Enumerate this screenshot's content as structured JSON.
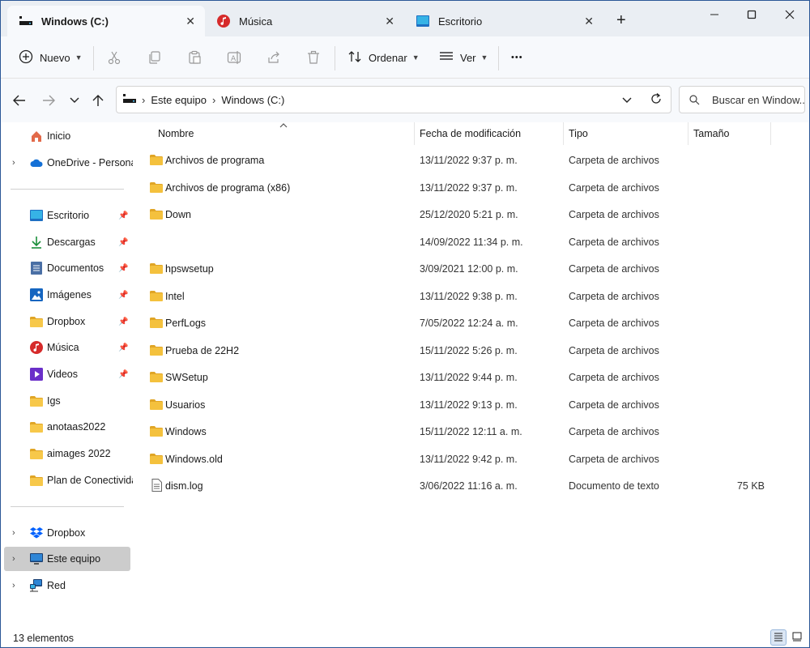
{
  "tabs": [
    {
      "label": "Windows (C:)",
      "icon": "drive-icon"
    },
    {
      "label": "Música",
      "icon": "music-icon"
    },
    {
      "label": "Escritorio",
      "icon": "desktop-icon"
    }
  ],
  "commandbar": {
    "new_label": "Nuevo",
    "sort_label": "Ordenar",
    "view_label": "Ver",
    "more_label": "•••"
  },
  "address": {
    "crumbs": [
      "Este equipo",
      "Windows (C:)"
    ]
  },
  "search": {
    "placeholder": "Buscar en Window..."
  },
  "sidebar": {
    "home": "Inicio",
    "onedrive": "OneDrive - Persona",
    "quick": [
      {
        "label": "Escritorio",
        "icon": "desktop-icon",
        "pinned": true
      },
      {
        "label": "Descargas",
        "icon": "download-icon",
        "pinned": true
      },
      {
        "label": "Documentos",
        "icon": "documents-icon",
        "pinned": true
      },
      {
        "label": "Imágenes",
        "icon": "pictures-icon",
        "pinned": true
      },
      {
        "label": "Dropbox",
        "icon": "folder-icon",
        "pinned": true
      },
      {
        "label": "Música",
        "icon": "music-icon",
        "pinned": true
      },
      {
        "label": "Videos",
        "icon": "videos-icon",
        "pinned": true
      },
      {
        "label": "Igs",
        "icon": "folder-icon",
        "pinned": false
      },
      {
        "label": "anotaas2022",
        "icon": "folder-icon",
        "pinned": false
      },
      {
        "label": "aimages 2022",
        "icon": "folder-icon",
        "pinned": false
      },
      {
        "label": "Plan de Conectividad",
        "icon": "folder-icon",
        "pinned": false
      }
    ],
    "bottom": [
      {
        "label": "Dropbox",
        "icon": "dropbox-icon"
      },
      {
        "label": "Este equipo",
        "icon": "computer-icon"
      },
      {
        "label": "Red",
        "icon": "network-icon"
      }
    ]
  },
  "columns": {
    "name": "Nombre",
    "date": "Fecha de modificación",
    "type": "Tipo",
    "size": "Tamaño"
  },
  "files": [
    {
      "name": "Archivos de programa",
      "date": "13/11/2022 9:37 p. m.",
      "type": "Carpeta de archivos",
      "size": "",
      "kind": "folder"
    },
    {
      "name": "Archivos de programa (x86)",
      "date": "13/11/2022 9:37 p. m.",
      "type": "Carpeta de archivos",
      "size": "",
      "kind": "folder"
    },
    {
      "name": "Down",
      "date": "25/12/2020 5:21 p. m.",
      "type": "Carpeta de archivos",
      "size": "",
      "kind": "folder"
    },
    {
      "name": "",
      "date": "14/09/2022 11:34 p. m.",
      "type": "Carpeta de archivos",
      "size": "",
      "kind": "none"
    },
    {
      "name": "hpswsetup",
      "date": "3/09/2021 12:00 p. m.",
      "type": "Carpeta de archivos",
      "size": "",
      "kind": "folder"
    },
    {
      "name": "Intel",
      "date": "13/11/2022 9:38 p. m.",
      "type": "Carpeta de archivos",
      "size": "",
      "kind": "folder"
    },
    {
      "name": "PerfLogs",
      "date": "7/05/2022 12:24 a. m.",
      "type": "Carpeta de archivos",
      "size": "",
      "kind": "folder"
    },
    {
      "name": "Prueba de 22H2",
      "date": "15/11/2022 5:26 p. m.",
      "type": "Carpeta de archivos",
      "size": "",
      "kind": "folder"
    },
    {
      "name": "SWSetup",
      "date": "13/11/2022 9:44 p. m.",
      "type": "Carpeta de archivos",
      "size": "",
      "kind": "folder"
    },
    {
      "name": "Usuarios",
      "date": "13/11/2022 9:13 p. m.",
      "type": "Carpeta de archivos",
      "size": "",
      "kind": "folder"
    },
    {
      "name": "Windows",
      "date": "15/11/2022 12:11 a. m.",
      "type": "Carpeta de archivos",
      "size": "",
      "kind": "folder"
    },
    {
      "name": "Windows.old",
      "date": "13/11/2022 9:42 p. m.",
      "type": "Carpeta de archivos",
      "size": "",
      "kind": "folder"
    },
    {
      "name": "dism.log",
      "date": "3/06/2022 11:16 a. m.",
      "type": "Documento de texto",
      "size": "75 KB",
      "kind": "text"
    }
  ],
  "status": {
    "count": "13 elementos"
  },
  "colors": {
    "folder": "#f4c13d",
    "folder_dark": "#e0a526",
    "accent": "#0063b1",
    "selected": "#cccccc"
  }
}
